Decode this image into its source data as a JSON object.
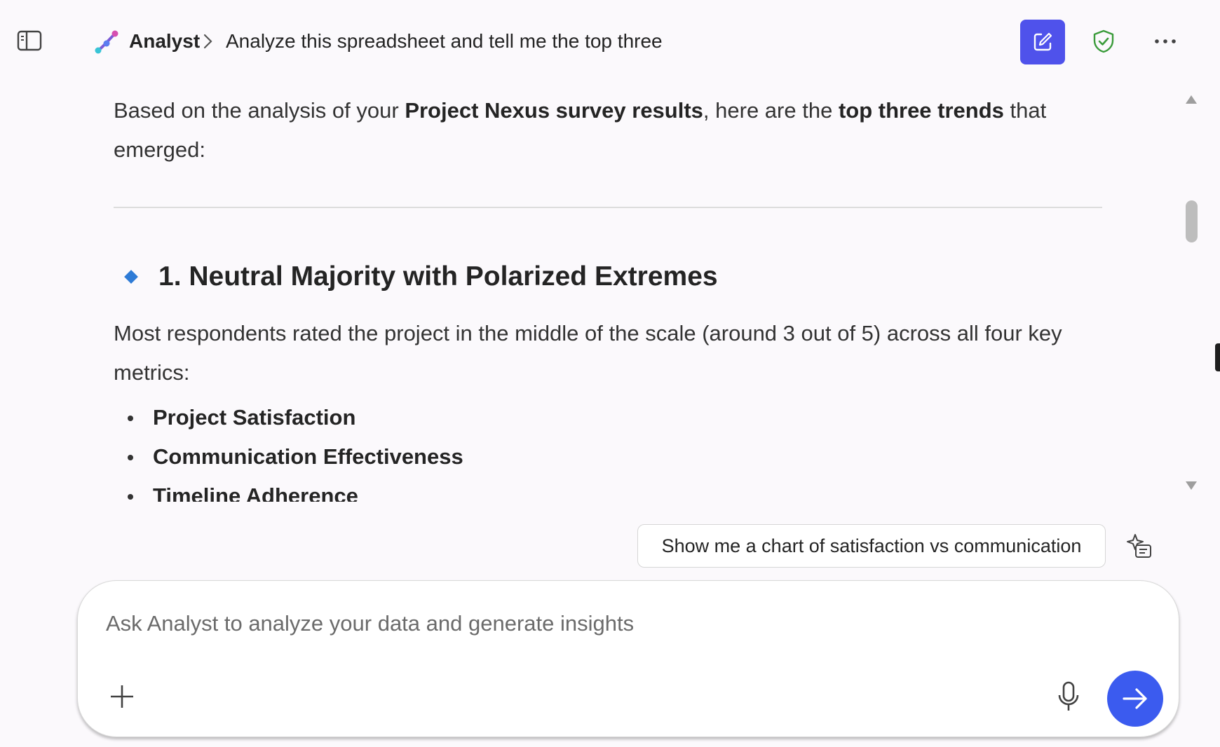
{
  "header": {
    "app_name": "Analyst",
    "conversation_title": "Analyze this spreadsheet and tell me the top three",
    "icons": [
      "sidebar-toggle-icon",
      "analyst-logo-icon",
      "chevron-right-icon",
      "compose-icon",
      "shield-check-icon",
      "more-icon"
    ],
    "accent_color": "#4f52eb"
  },
  "message": {
    "intro_pre": "Based on the analysis of your ",
    "intro_bold1": "Project Nexus survey results",
    "intro_mid": ", here are the ",
    "intro_bold2": "top three trends",
    "intro_post": " that emerged:",
    "heading": "1. Neutral Majority with Polarized Extremes",
    "body": "Most respondents rated the project in the middle of the scale (around 3 out of 5) across all four key metrics:",
    "bullets": [
      "Project Satisfaction",
      "Communication Effectiveness",
      "Timeline Adherence"
    ]
  },
  "suggestion": {
    "label": "Show me a chart of satisfaction vs communication"
  },
  "composer": {
    "placeholder": "Ask Analyst to analyze your data and generate insights",
    "value": "",
    "send_color": "#3b5bef"
  }
}
